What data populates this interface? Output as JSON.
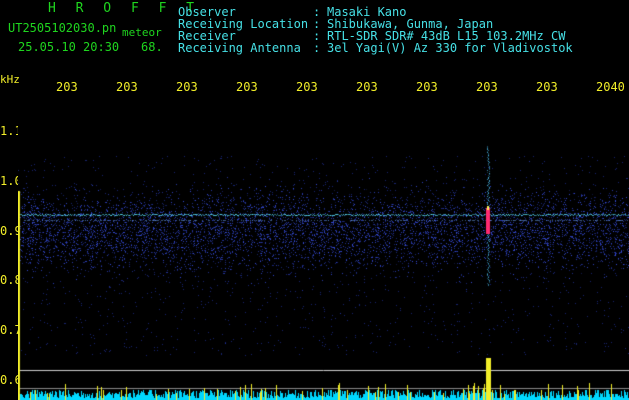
{
  "header": {
    "app_name": "H R O F F T",
    "filename": "UT2505102030.pn",
    "meteor_label": "meteor",
    "datetime": "25.05.10 20:30",
    "count": "68."
  },
  "info": [
    {
      "label": "Observer",
      "value": "Masaki Kano"
    },
    {
      "label": "Receiving Location",
      "value": "Shibukawa, Gunma, Japan"
    },
    {
      "label": "Receiver",
      "value": "RTL-SDR SDR# 43dB L15 103.2MHz CW"
    },
    {
      "label": "Receiving Antenna",
      "value": "3el Yagi(V) Az 330 for Vladivostok"
    }
  ],
  "colon": ":",
  "axis": {
    "y_unit": "kHz",
    "x_ticks": [
      "203",
      "203",
      "203",
      "203",
      "203",
      "203",
      "203",
      "203",
      "203",
      "2040"
    ],
    "y_ticks": [
      "1.1",
      "1.0",
      "0.9",
      "0.8",
      "0.7",
      "0.6"
    ]
  },
  "colors": {
    "background": "#000000",
    "title_green": "#1fd51f",
    "info_cyan": "#46e0e6",
    "axis_yellow": "#f2ee29",
    "noise_blue": "#2a39c8",
    "carrier_cyan": "#5ce8ff",
    "meteor_red": "#ff2a70",
    "bar_cyan": "#00d8ff"
  }
}
